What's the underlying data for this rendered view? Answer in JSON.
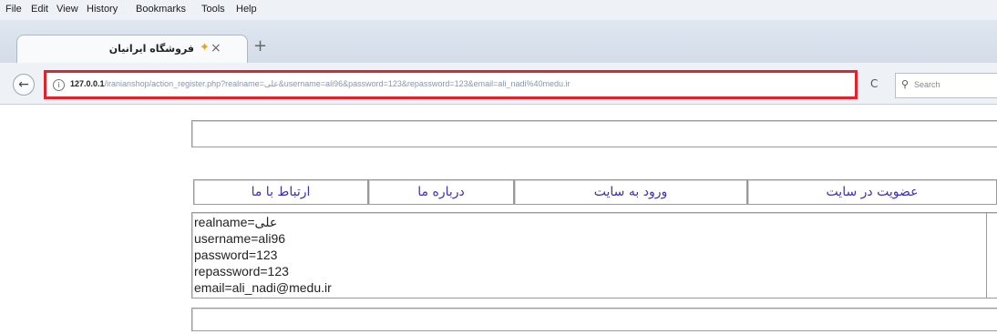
{
  "menu": {
    "file": "File",
    "edit": "Edit",
    "view": "View",
    "history": "History",
    "bookmarks": "Bookmarks",
    "tools": "Tools",
    "help": "Help"
  },
  "tab": {
    "title": "فروشگاه ایرانیان",
    "close": "×",
    "new_tab": "+"
  },
  "nav": {
    "url_host": "127.0.0.1",
    "url_rest": "/iranianshop/action_register.php?realname=علی&username=ali96&password=123&repassword=123&email=ali_nadi%40medu.ir",
    "search_placeholder": "Search"
  },
  "site_nav": {
    "contact": "ارتباط با ما",
    "about": "درباره ما",
    "login": "ورود به سایت",
    "register": "عضویت در سایت"
  },
  "result_lines": [
    "realname=علی",
    "username=ali96",
    "password=123",
    "repassword=123",
    "email=ali_nadi@medu.ir"
  ]
}
